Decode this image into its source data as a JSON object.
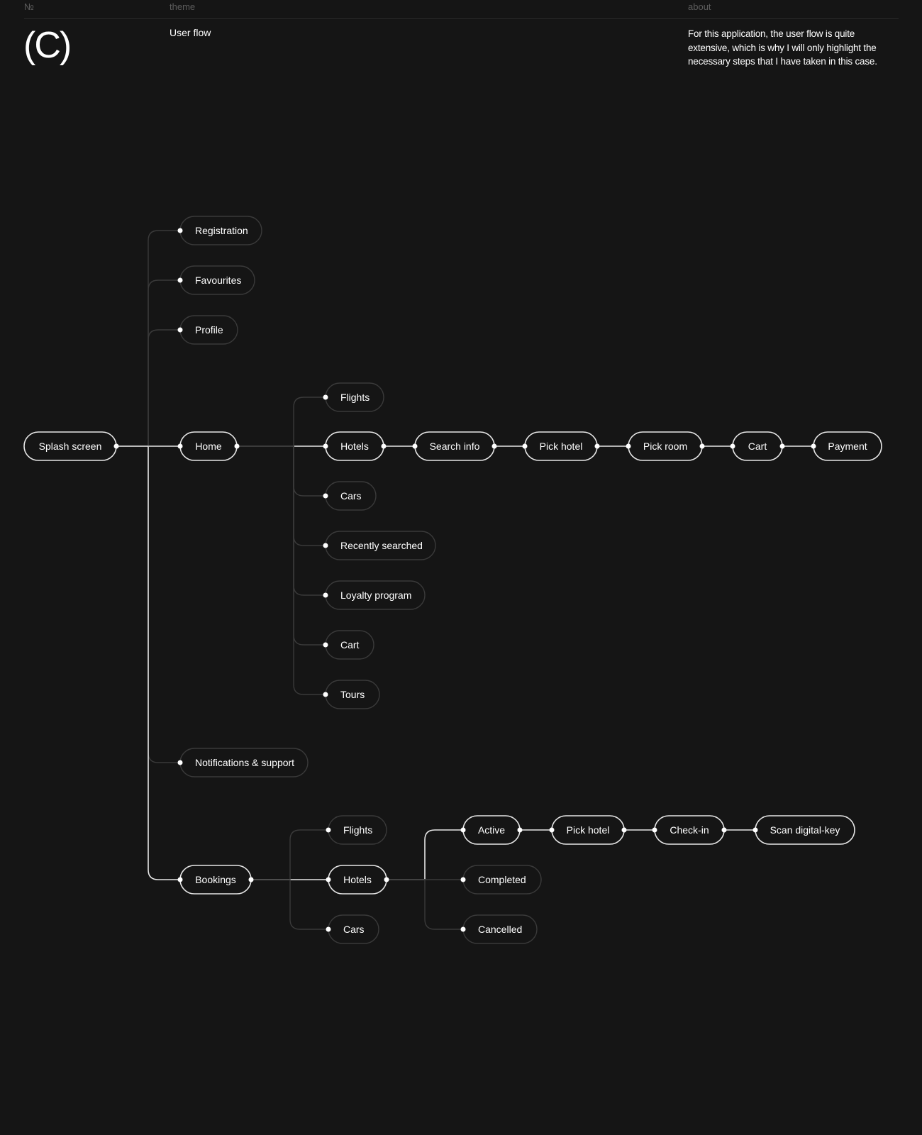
{
  "header": {
    "number_label": "№",
    "theme_label": "theme",
    "about_label": "about",
    "logo": "(C)",
    "theme_value": "User flow",
    "about_value": "For this application, the user flow is quite extensive, which is why I will only highlight the necessary steps that I have taken in this case."
  },
  "colors": {
    "background": "#151515",
    "active": "#e6e6e6",
    "inactive": "#3a3a3a",
    "text": "#ffffff"
  },
  "flow": {
    "nodes": [
      {
        "id": "splash",
        "label": "Splash screen",
        "active": true
      },
      {
        "id": "home",
        "label": "Home",
        "active": true
      },
      {
        "id": "registration",
        "label": "Registration",
        "active": false
      },
      {
        "id": "favourites",
        "label": "Favourites",
        "active": false
      },
      {
        "id": "profile",
        "label": "Profile",
        "active": false
      },
      {
        "id": "notifications",
        "label": "Notifications & support",
        "active": false
      },
      {
        "id": "bookings",
        "label": "Bookings",
        "active": true
      },
      {
        "id": "home-flights",
        "label": "Flights",
        "active": false
      },
      {
        "id": "home-hotels",
        "label": "Hotels",
        "active": true
      },
      {
        "id": "home-cars",
        "label": "Cars",
        "active": false
      },
      {
        "id": "recently",
        "label": "Recently searched",
        "active": false
      },
      {
        "id": "loyalty",
        "label": "Loyalty program",
        "active": false
      },
      {
        "id": "home-cart",
        "label": "Cart",
        "active": false
      },
      {
        "id": "tours",
        "label": "Tours",
        "active": false
      },
      {
        "id": "search-info",
        "label": "Search info",
        "active": true
      },
      {
        "id": "pick-hotel",
        "label": "Pick hotel",
        "active": true
      },
      {
        "id": "pick-room",
        "label": "Pick room",
        "active": true
      },
      {
        "id": "cart",
        "label": "Cart",
        "active": true
      },
      {
        "id": "payment",
        "label": "Payment",
        "active": true
      },
      {
        "id": "bk-flights",
        "label": "Flights",
        "active": false
      },
      {
        "id": "bk-hotels",
        "label": "Hotels",
        "active": true
      },
      {
        "id": "bk-cars",
        "label": "Cars",
        "active": false
      },
      {
        "id": "active",
        "label": "Active",
        "active": true
      },
      {
        "id": "completed",
        "label": "Completed",
        "active": false
      },
      {
        "id": "cancelled",
        "label": "Cancelled",
        "active": false
      },
      {
        "id": "bk-pick-hotel",
        "label": "Pick hotel",
        "active": true
      },
      {
        "id": "check-in",
        "label": "Check-in",
        "active": true
      },
      {
        "id": "scan-key",
        "label": "Scan digital-key",
        "active": true
      }
    ],
    "edges": [
      {
        "from": "splash",
        "to": "home",
        "active": true
      },
      {
        "from": "splash",
        "to": "registration",
        "active": false
      },
      {
        "from": "splash",
        "to": "favourites",
        "active": false
      },
      {
        "from": "splash",
        "to": "profile",
        "active": false
      },
      {
        "from": "splash",
        "to": "notifications",
        "active": false
      },
      {
        "from": "splash",
        "to": "bookings",
        "active": true
      },
      {
        "from": "home",
        "to": "home-flights",
        "active": false
      },
      {
        "from": "home",
        "to": "home-hotels",
        "active": true
      },
      {
        "from": "home",
        "to": "home-cars",
        "active": false
      },
      {
        "from": "home",
        "to": "recently",
        "active": false
      },
      {
        "from": "home",
        "to": "loyalty",
        "active": false
      },
      {
        "from": "home",
        "to": "home-cart",
        "active": false
      },
      {
        "from": "home",
        "to": "tours",
        "active": false
      },
      {
        "from": "home-hotels",
        "to": "search-info",
        "active": true
      },
      {
        "from": "search-info",
        "to": "pick-hotel",
        "active": true
      },
      {
        "from": "pick-hotel",
        "to": "pick-room",
        "active": true
      },
      {
        "from": "pick-room",
        "to": "cart",
        "active": true
      },
      {
        "from": "cart",
        "to": "payment",
        "active": true
      },
      {
        "from": "bookings",
        "to": "bk-flights",
        "active": false
      },
      {
        "from": "bookings",
        "to": "bk-hotels",
        "active": true
      },
      {
        "from": "bookings",
        "to": "bk-cars",
        "active": false
      },
      {
        "from": "bk-hotels",
        "to": "active",
        "active": true
      },
      {
        "from": "bk-hotels",
        "to": "completed",
        "active": false
      },
      {
        "from": "bk-hotels",
        "to": "cancelled",
        "active": false
      },
      {
        "from": "active",
        "to": "bk-pick-hotel",
        "active": true
      },
      {
        "from": "bk-pick-hotel",
        "to": "check-in",
        "active": true
      },
      {
        "from": "check-in",
        "to": "scan-key",
        "active": true
      }
    ]
  }
}
